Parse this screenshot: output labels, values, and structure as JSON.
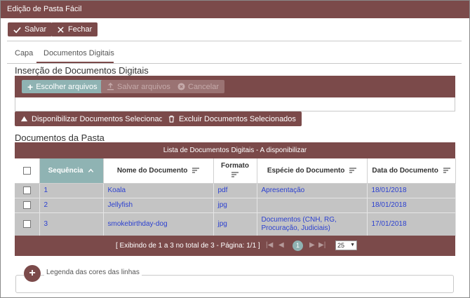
{
  "window": {
    "title": "Edição de Pasta Fácil"
  },
  "toolbar": {
    "save_label": "Salvar",
    "close_label": "Fechar"
  },
  "tabs": [
    {
      "label": "Capa",
      "active": false
    },
    {
      "label": "Documentos Digitais",
      "active": true
    }
  ],
  "insertion": {
    "title": "Inserção de Documentos Digitais",
    "choose_label": "Escolher arquivos",
    "save_files_label": "Salvar arquivos",
    "cancel_label": "Cancelar"
  },
  "actions": {
    "publish_label": "Disponibilizar Documentos Selecionados",
    "delete_label": "Excluir Documentos Selecionados"
  },
  "folder_docs": {
    "title": "Documentos da Pasta",
    "grid_caption": "Lista de Documentos Digitais - A disponibilizar",
    "columns": [
      "Sequência",
      "Nome do Documento",
      "Formato",
      "Espécie do Documento",
      "Data do Documento"
    ],
    "rows": [
      {
        "seq": "1",
        "name": "Koala",
        "format": "pdf",
        "species": "Apresentação",
        "date": "18/01/2018"
      },
      {
        "seq": "2",
        "name": "Jellyfish",
        "format": "jpg",
        "species": "",
        "date": "18/01/2018"
      },
      {
        "seq": "3",
        "name": "smokebirthday-dog",
        "format": "jpg",
        "species": "Documentos (CNH, RG, Procuração, Judiciais)",
        "date": "17/01/2018"
      }
    ],
    "pager": {
      "summary": "[ Exibindo de 1 a 3 no total de 3 - Página: 1/1 ]",
      "current_page": "1",
      "page_size": "25"
    }
  },
  "legend": {
    "label": "Legenda das cores das linhas"
  },
  "colors": {
    "brand": "#7b4a4a",
    "accent": "#8fb3b3",
    "row_bg": "#c4c4c4",
    "link": "#2a3fd0"
  }
}
